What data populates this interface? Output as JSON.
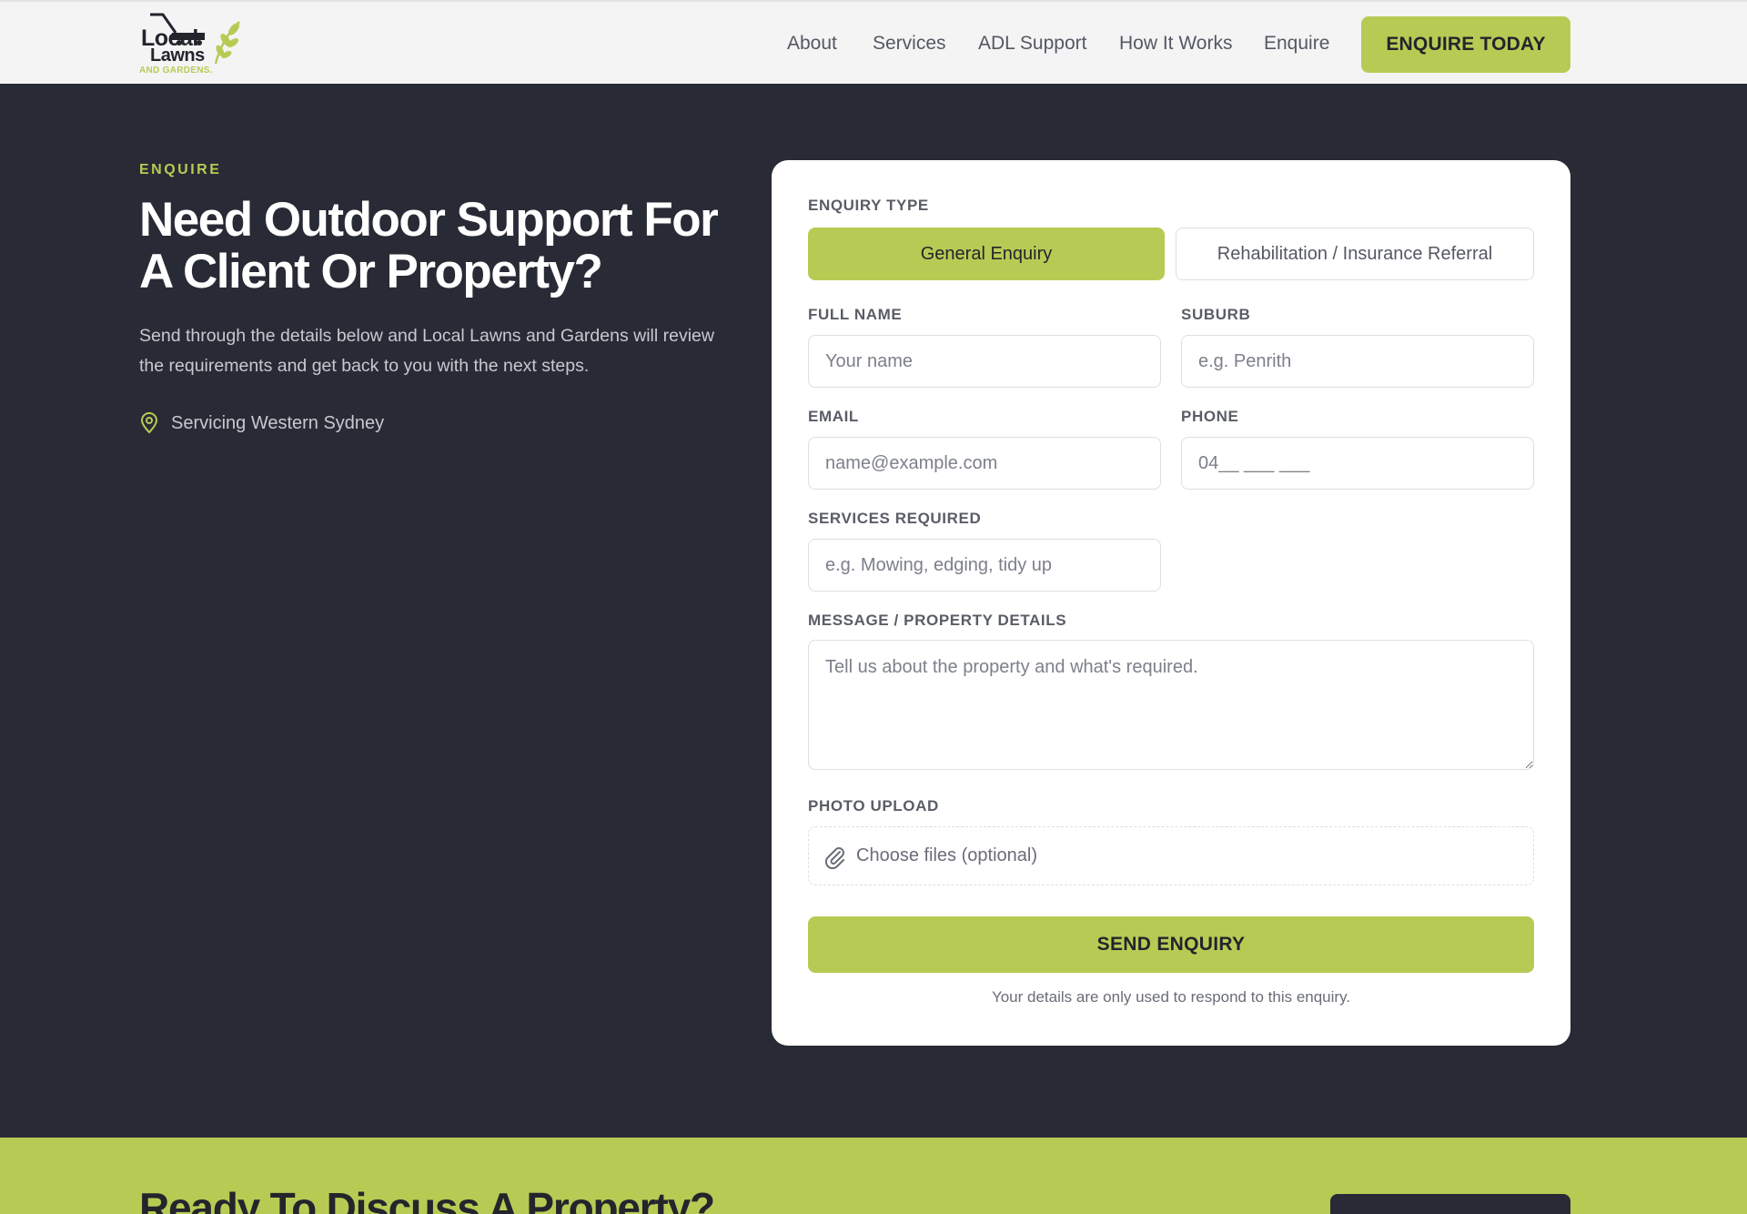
{
  "brand": {
    "logo_line1": "Local",
    "logo_line2": "Lawns",
    "logo_line3": "AND GARDENS.",
    "accent_color": "#b7cb54",
    "dark_color": "#282b35"
  },
  "nav": {
    "items": [
      "About",
      "Services",
      "ADL Support",
      "How It Works",
      "Enquire"
    ],
    "cta_label": "ENQUIRE TODAY"
  },
  "hero": {
    "eyebrow": "ENQUIRE",
    "title": "Need Outdoor Support For A Client Or Property?",
    "subtitle": "Send through the details below and Local Lawns and Gardens will review the requirements and get back to you with the next steps.",
    "location_icon": "map-pin-icon",
    "location": "Servicing Western Sydney"
  },
  "form": {
    "enquiry_type_label": "ENQUIRY TYPE",
    "types": [
      "General Enquiry",
      "Rehabilitation / Insurance Referral"
    ],
    "selected_type": "General Enquiry",
    "full_name": {
      "label": "FULL NAME",
      "placeholder": "Your name",
      "value": ""
    },
    "suburb": {
      "label": "SUBURB",
      "placeholder": "e.g. Penrith",
      "value": ""
    },
    "email": {
      "label": "EMAIL",
      "placeholder": "name@example.com",
      "value": ""
    },
    "phone": {
      "label": "PHONE",
      "placeholder": "04__ ___ ___",
      "value": ""
    },
    "services": {
      "label": "SERVICES REQUIRED",
      "placeholder": "e.g. Mowing, edging, tidy up",
      "value": ""
    },
    "message": {
      "label": "MESSAGE / PROPERTY DETAILS",
      "placeholder": "Tell us about the property and what's required.",
      "value": ""
    },
    "upload": {
      "label": "PHOTO UPLOAD",
      "icon": "paperclip-icon",
      "text": "Choose files (optional)"
    },
    "submit_label": "SEND ENQUIRY",
    "privacy_note": "Your details are only used to respond to this enquiry."
  },
  "cta": {
    "title": "Ready To Discuss A Property?"
  }
}
